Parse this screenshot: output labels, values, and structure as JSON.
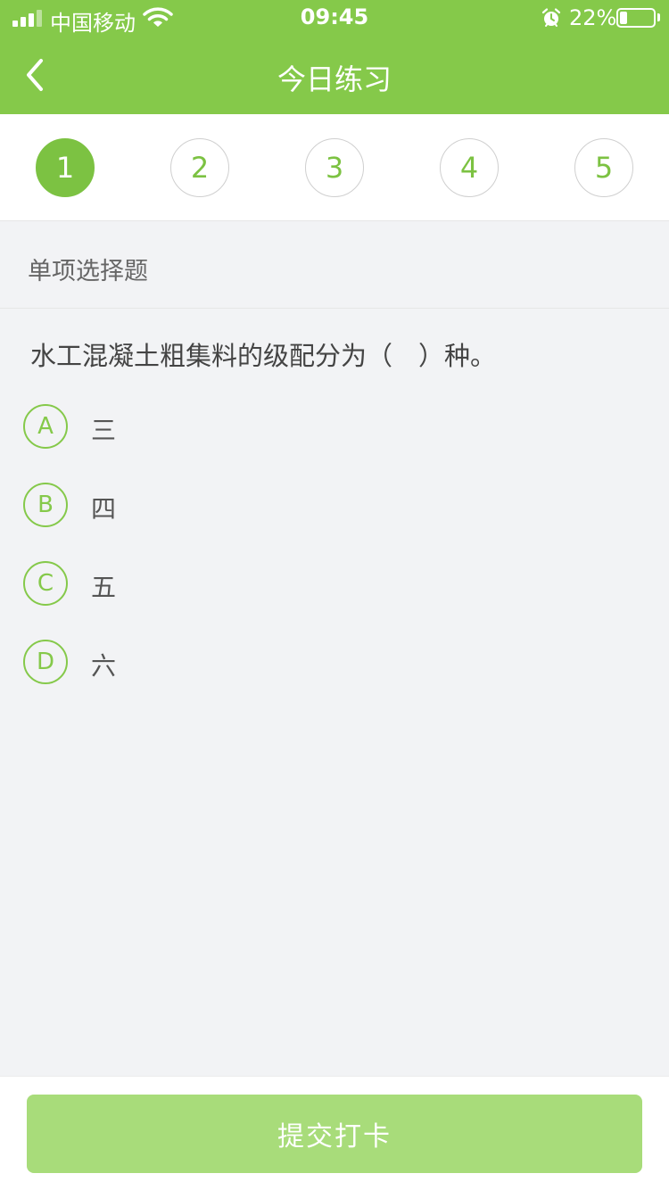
{
  "status_bar": {
    "carrier": "中国移动",
    "time": "09:45",
    "battery_percent": "22%",
    "battery_level": 0.22,
    "icons": [
      "signal-icon",
      "wifi-icon",
      "alarm-icon",
      "battery-icon"
    ]
  },
  "nav": {
    "title": "今日练习",
    "back_icon": "chevron-left-icon"
  },
  "question_nav": {
    "items": [
      "1",
      "2",
      "3",
      "4",
      "5"
    ],
    "active_index": 0
  },
  "section": {
    "label": "单项选择题"
  },
  "question": {
    "text": "水工混凝土粗集料的级配分为（　）种。",
    "options": [
      {
        "letter": "A",
        "text": "三"
      },
      {
        "letter": "B",
        "text": "四"
      },
      {
        "letter": "C",
        "text": "五"
      },
      {
        "letter": "D",
        "text": "六"
      }
    ]
  },
  "footer": {
    "submit_label": "提交打卡"
  },
  "colors": {
    "brand_green": "#85c94a",
    "active_green": "#7cc242",
    "submit_disabled_green": "#a8dc7a",
    "background": "#f2f3f5"
  }
}
